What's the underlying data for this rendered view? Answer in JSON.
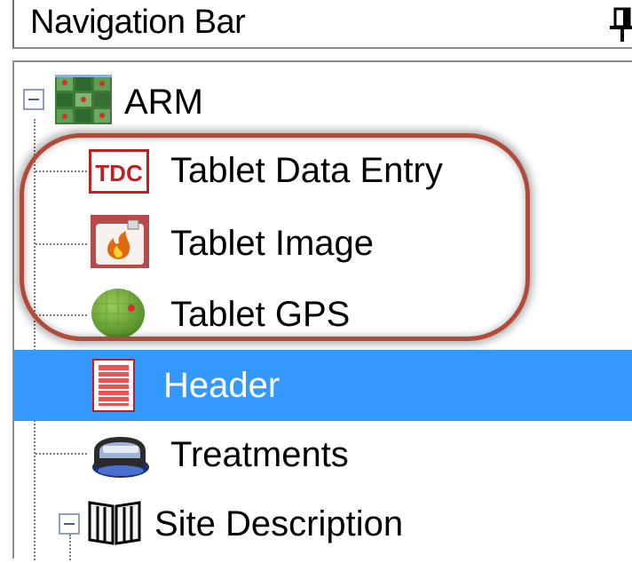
{
  "header": {
    "title": "Navigation Bar"
  },
  "tree": {
    "root": {
      "label": "ARM",
      "icon": "arm-grid-icon",
      "expanded": true
    },
    "children": [
      {
        "label": "Tablet Data Entry",
        "icon": "tdc-icon",
        "icon_text": "TDC"
      },
      {
        "label": "Tablet Image",
        "icon": "camera-flame-icon"
      },
      {
        "label": "Tablet GPS",
        "icon": "gps-globe-icon"
      },
      {
        "label": "Header",
        "icon": "header-document-icon",
        "selected": true
      },
      {
        "label": "Treatments",
        "icon": "treatments-sprayer-icon"
      },
      {
        "label": "Site Description",
        "icon": "book-icon",
        "expanded": true
      }
    ]
  },
  "colors": {
    "selection": "#3399ff",
    "highlight_ring": "#b04a3a"
  }
}
